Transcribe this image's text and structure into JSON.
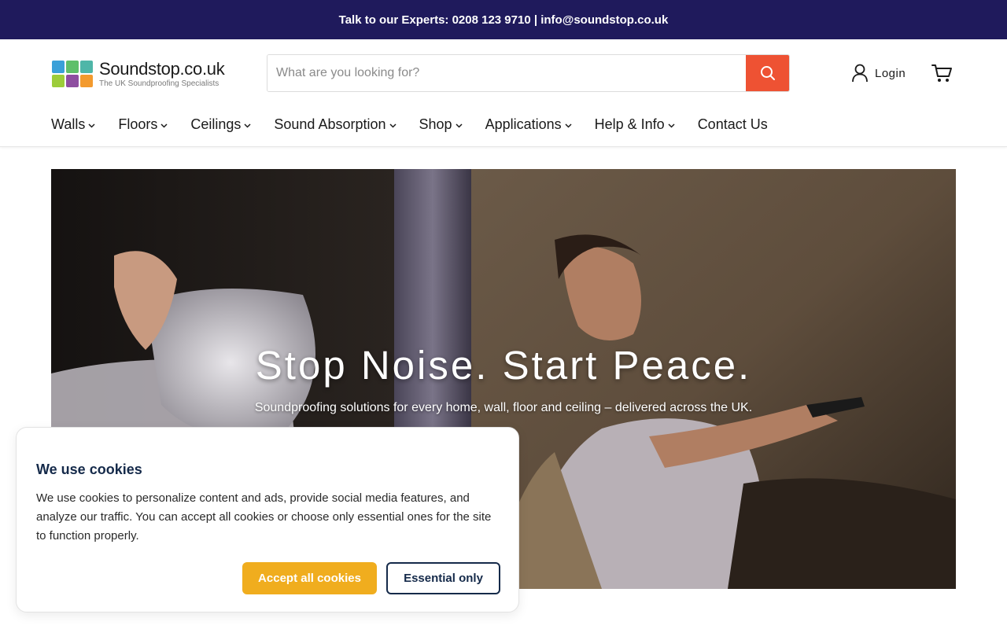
{
  "announcement": {
    "text": "Talk to our Experts: 0208 123 9710 | info@soundstop.co.uk"
  },
  "logo": {
    "name": "Soundstop.co.uk",
    "tagline": "The UK Soundproofing Specialists"
  },
  "search": {
    "placeholder": "What are you looking for?",
    "icon": "search-icon"
  },
  "account": {
    "login_label": "Login",
    "icon": "user-icon"
  },
  "cart": {
    "icon": "cart-icon"
  },
  "nav": {
    "items": [
      {
        "label": "Walls",
        "dropdown": true
      },
      {
        "label": "Floors",
        "dropdown": true
      },
      {
        "label": "Ceilings",
        "dropdown": true
      },
      {
        "label": "Sound Absorption",
        "dropdown": true
      },
      {
        "label": "Shop",
        "dropdown": true
      },
      {
        "label": "Applications",
        "dropdown": true
      },
      {
        "label": "Help & Info",
        "dropdown": true
      },
      {
        "label": "Contact Us",
        "dropdown": false
      }
    ]
  },
  "hero": {
    "title": "Stop Noise. Start Peace.",
    "subtitle": "Soundproofing solutions for every home, wall, floor and ceiling – delivered across the UK."
  },
  "cookie": {
    "title": "We use cookies",
    "body": "We use cookies to personalize content and ads, provide social media features, and analyze our traffic. You can accept all cookies or choose only essential ones for the site to function properly.",
    "accept_label": "Accept all cookies",
    "essential_label": "Essential only"
  },
  "colors": {
    "announcement_bg": "#1f1a5c",
    "search_button": "#ee5233",
    "accept_button": "#f0ad1e",
    "cookie_navy": "#152a4a"
  }
}
